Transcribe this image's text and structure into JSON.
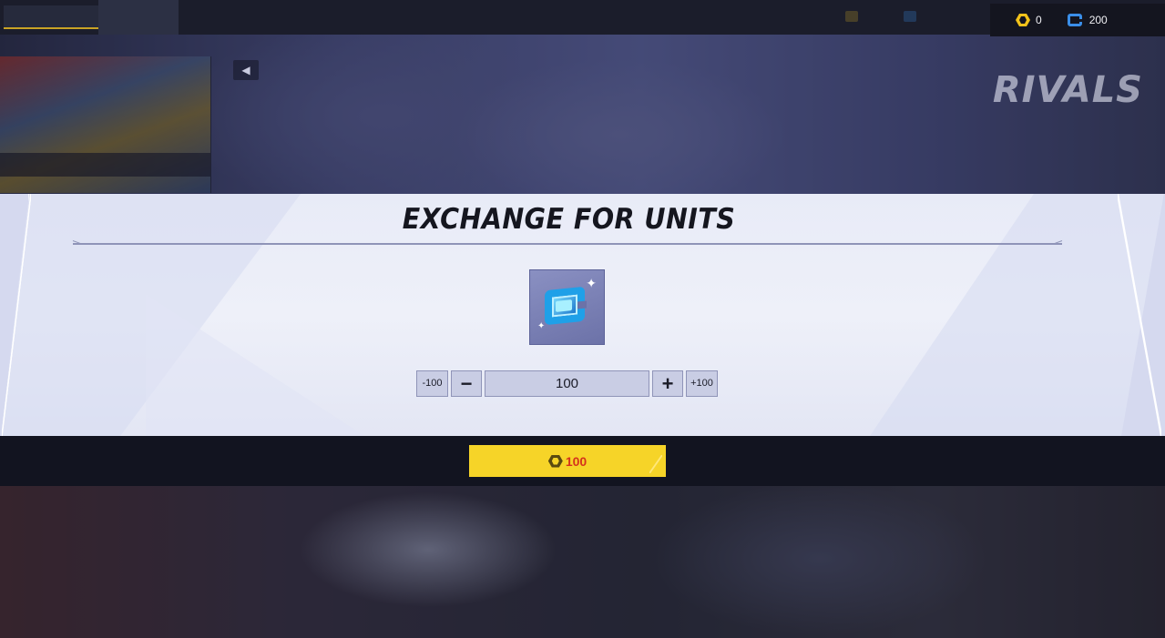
{
  "topbar": {
    "currencies": [
      {
        "name": "lattice",
        "icon": "lattice-icon",
        "value": "0",
        "color": "#f2c21a"
      },
      {
        "name": "units",
        "icon": "units-icon",
        "value": "200",
        "color": "#3a8ee8"
      }
    ]
  },
  "background": {
    "logo_text": "RIVALS"
  },
  "dialog": {
    "title": "EXCHANGE FOR UNITS",
    "item_icon": "units-chip-icon",
    "stepper": {
      "minus_100_label": "-100",
      "minus_1_label": "−",
      "quantity": "100",
      "plus_1_label": "+",
      "plus_100_label": "+100"
    }
  },
  "confirm": {
    "cost_icon": "lattice-icon",
    "cost": "100",
    "button_color": "#f6d428",
    "cost_color": "#d4321c"
  }
}
